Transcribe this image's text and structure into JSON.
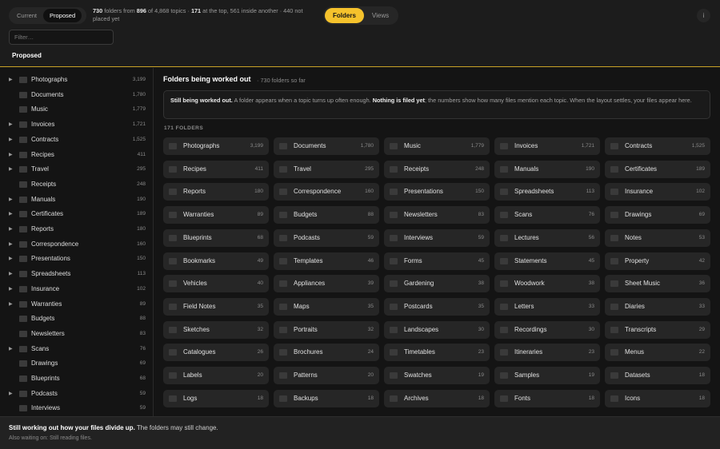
{
  "tabs": {
    "current": "Current",
    "proposed": "Proposed"
  },
  "summary": {
    "folders": "730",
    "t1": " folders from ",
    "topics_used": "896",
    "t2": " of 4,868 topics · ",
    "top": "171",
    "t3": " at the top, 561 inside another · 440 not placed yet"
  },
  "toggle": {
    "folders": "Folders",
    "views": "Views"
  },
  "info_label": "i",
  "filter": {
    "placeholder": "Filter…",
    "value": ""
  },
  "view_label": "Proposed",
  "main": {
    "title": "Folders being worked out",
    "subtitle": "· 730 folders so far",
    "notice": {
      "b1": "Still being worked out.",
      "t1": " A folder appears when a topic turns up often enough. ",
      "b2": "Nothing is filed yet",
      "t2": "; the numbers show how many files mention each topic. When the layout settles, your files appear here."
    },
    "count_label": "171 FOLDERS"
  },
  "sidebar": [
    {
      "name": "Photographs",
      "count": "3,199",
      "expandable": true
    },
    {
      "name": "Documents",
      "count": "1,780",
      "expandable": false
    },
    {
      "name": "Music",
      "count": "1,779",
      "expandable": false
    },
    {
      "name": "Invoices",
      "count": "1,721",
      "expandable": true
    },
    {
      "name": "Contracts",
      "count": "1,525",
      "expandable": true
    },
    {
      "name": "Recipes",
      "count": "411",
      "expandable": true
    },
    {
      "name": "Travel",
      "count": "295",
      "expandable": true
    },
    {
      "name": "Receipts",
      "count": "248",
      "expandable": false
    },
    {
      "name": "Manuals",
      "count": "190",
      "expandable": true
    },
    {
      "name": "Certificates",
      "count": "189",
      "expandable": true
    },
    {
      "name": "Reports",
      "count": "180",
      "expandable": true
    },
    {
      "name": "Correspondence",
      "count": "160",
      "expandable": true
    },
    {
      "name": "Presentations",
      "count": "150",
      "expandable": true
    },
    {
      "name": "Spreadsheets",
      "count": "113",
      "expandable": true
    },
    {
      "name": "Insurance",
      "count": "102",
      "expandable": true
    },
    {
      "name": "Warranties",
      "count": "89",
      "expandable": true
    },
    {
      "name": "Budgets",
      "count": "88",
      "expandable": false
    },
    {
      "name": "Newsletters",
      "count": "83",
      "expandable": false
    },
    {
      "name": "Scans",
      "count": "76",
      "expandable": true
    },
    {
      "name": "Drawings",
      "count": "69",
      "expandable": false
    },
    {
      "name": "Blueprints",
      "count": "68",
      "expandable": false
    },
    {
      "name": "Podcasts",
      "count": "59",
      "expandable": true
    },
    {
      "name": "Interviews",
      "count": "59",
      "expandable": false
    }
  ],
  "cards": [
    [
      "Photographs",
      "3,199"
    ],
    [
      "Documents",
      "1,780"
    ],
    [
      "Music",
      "1,779"
    ],
    [
      "Invoices",
      "1,721"
    ],
    [
      "Contracts",
      "1,525"
    ],
    [
      "Recipes",
      "411"
    ],
    [
      "Travel",
      "295"
    ],
    [
      "Receipts",
      "248"
    ],
    [
      "Manuals",
      "190"
    ],
    [
      "Certificates",
      "189"
    ],
    [
      "Reports",
      "180"
    ],
    [
      "Correspondence",
      "160"
    ],
    [
      "Presentations",
      "150"
    ],
    [
      "Spreadsheets",
      "113"
    ],
    [
      "Insurance",
      "102"
    ],
    [
      "Warranties",
      "89"
    ],
    [
      "Budgets",
      "88"
    ],
    [
      "Newsletters",
      "83"
    ],
    [
      "Scans",
      "76"
    ],
    [
      "Drawings",
      "69"
    ],
    [
      "Blueprints",
      "68"
    ],
    [
      "Podcasts",
      "59"
    ],
    [
      "Interviews",
      "59"
    ],
    [
      "Lectures",
      "56"
    ],
    [
      "Notes",
      "53"
    ],
    [
      "Bookmarks",
      "49"
    ],
    [
      "Templates",
      "46"
    ],
    [
      "Forms",
      "45"
    ],
    [
      "Statements",
      "45"
    ],
    [
      "Property",
      "42"
    ],
    [
      "Vehicles",
      "40"
    ],
    [
      "Appliances",
      "39"
    ],
    [
      "Gardening",
      "38"
    ],
    [
      "Woodwork",
      "38"
    ],
    [
      "Sheet Music",
      "36"
    ],
    [
      "Field Notes",
      "35"
    ],
    [
      "Maps",
      "35"
    ],
    [
      "Postcards",
      "35"
    ],
    [
      "Letters",
      "33"
    ],
    [
      "Diaries",
      "33"
    ],
    [
      "Sketches",
      "32"
    ],
    [
      "Portraits",
      "32"
    ],
    [
      "Landscapes",
      "30"
    ],
    [
      "Recordings",
      "30"
    ],
    [
      "Transcripts",
      "29"
    ],
    [
      "Catalogues",
      "26"
    ],
    [
      "Brochures",
      "24"
    ],
    [
      "Timetables",
      "23"
    ],
    [
      "Itineraries",
      "23"
    ],
    [
      "Menus",
      "22"
    ],
    [
      "Labels",
      "20"
    ],
    [
      "Patterns",
      "20"
    ],
    [
      "Swatches",
      "19"
    ],
    [
      "Samples",
      "19"
    ],
    [
      "Datasets",
      "18"
    ],
    [
      "Logs",
      "18"
    ],
    [
      "Backups",
      "18"
    ],
    [
      "Archives",
      "18"
    ],
    [
      "Fonts",
      "18"
    ],
    [
      "Icons",
      "18"
    ]
  ],
  "footer": {
    "bold": "Still working out how your files divide up.",
    "rest": " The folders may still change.",
    "line2": "Also waiting on: Still reading files."
  },
  "colors": {
    "accent": "#f5c22c",
    "background": "#141414",
    "card": "#262626"
  }
}
